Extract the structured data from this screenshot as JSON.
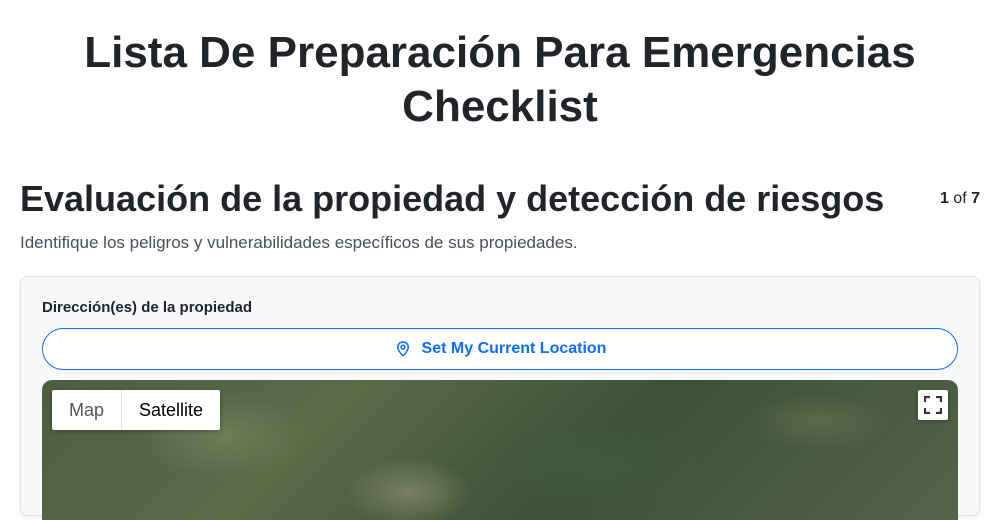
{
  "page": {
    "title_line1": "Lista De Preparación Para Emergencias",
    "title_line2": "Checklist"
  },
  "section": {
    "title": "Evaluación de la propiedad y detección de riesgos",
    "step_current": "1",
    "step_of": "of",
    "step_total": "7",
    "description": "Identifique los peligros y vulnerabilidades específicos de sus propiedades."
  },
  "form": {
    "address_label": "Dirección(es) de la propiedad",
    "location_button_label": "Set My Current Location",
    "location_icon": "map-pin-icon"
  },
  "map": {
    "type_options": [
      "Map",
      "Satellite"
    ],
    "selected_type": "Satellite",
    "fullscreen_icon": "fullscreen-icon"
  },
  "colors": {
    "accent": "#0d6efd",
    "card_background": "#f8f9fa",
    "text": "#212529"
  }
}
